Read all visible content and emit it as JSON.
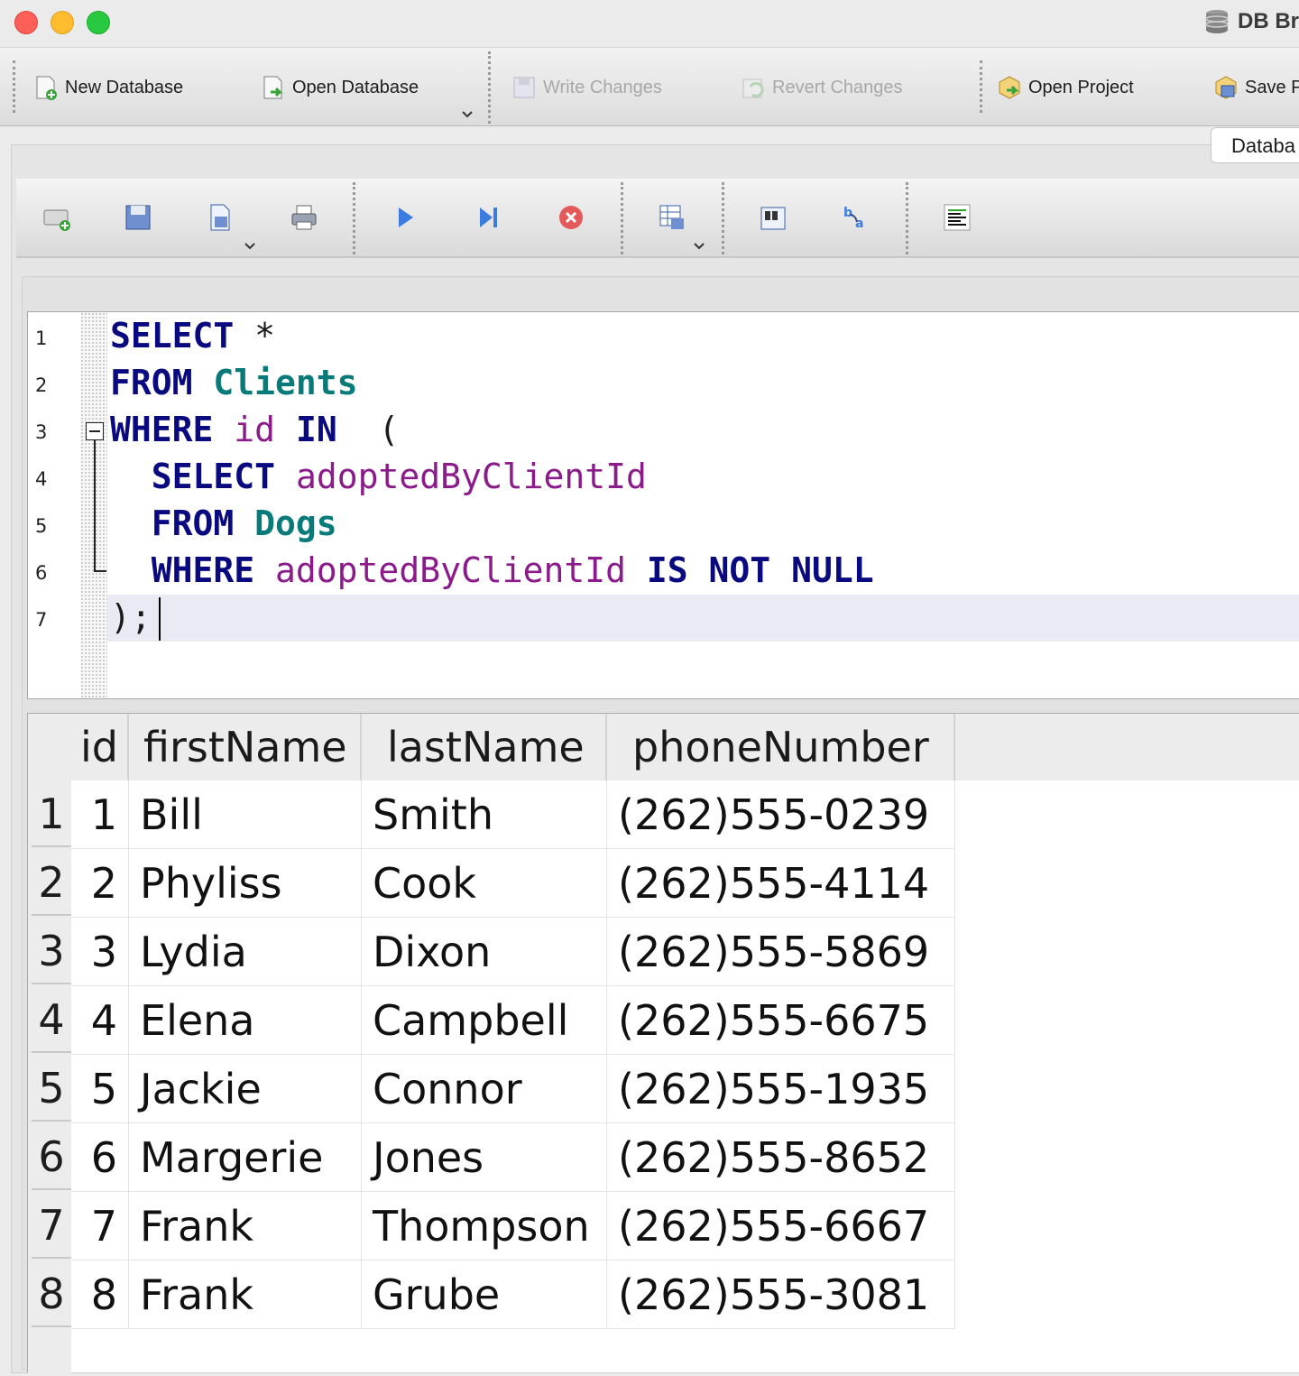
{
  "window": {
    "title": "DB Br"
  },
  "toolbar": {
    "new_database": "New Database",
    "open_database": "Open Database",
    "write_changes": "Write Changes",
    "revert_changes": "Revert Changes",
    "open_project": "Open Project",
    "save_project": "Save P"
  },
  "tabs": {
    "active": "Databa"
  },
  "editor": {
    "line_numbers": [
      "1",
      "2",
      "3",
      "4",
      "5",
      "6",
      "7"
    ],
    "lines": [
      [
        {
          "t": "kw",
          "v": "SELECT"
        },
        {
          "t": "p",
          "v": " *"
        }
      ],
      [
        {
          "t": "kw",
          "v": "FROM"
        },
        {
          "t": "p",
          "v": " "
        },
        {
          "t": "tbl",
          "v": "Clients"
        }
      ],
      [
        {
          "t": "kw",
          "v": "WHERE"
        },
        {
          "t": "p",
          "v": " "
        },
        {
          "t": "col",
          "v": "id"
        },
        {
          "t": "p",
          "v": " "
        },
        {
          "t": "kw",
          "v": "IN"
        },
        {
          "t": "p",
          "v": "  ("
        }
      ],
      [
        {
          "t": "p",
          "v": "  "
        },
        {
          "t": "kw",
          "v": "SELECT"
        },
        {
          "t": "p",
          "v": " "
        },
        {
          "t": "col",
          "v": "adoptedByClientId"
        }
      ],
      [
        {
          "t": "p",
          "v": "  "
        },
        {
          "t": "kw",
          "v": "FROM"
        },
        {
          "t": "p",
          "v": " "
        },
        {
          "t": "tbl",
          "v": "Dogs"
        }
      ],
      [
        {
          "t": "p",
          "v": "  "
        },
        {
          "t": "kw",
          "v": "WHERE"
        },
        {
          "t": "p",
          "v": " "
        },
        {
          "t": "col",
          "v": "adoptedByClientId"
        },
        {
          "t": "p",
          "v": " "
        },
        {
          "t": "kw",
          "v": "IS"
        },
        {
          "t": "p",
          "v": " "
        },
        {
          "t": "kw",
          "v": "NOT"
        },
        {
          "t": "p",
          "v": " "
        },
        {
          "t": "kw",
          "v": "NULL"
        }
      ],
      [
        {
          "t": "p",
          "v": ");"
        }
      ]
    ]
  },
  "results": {
    "columns": [
      "id",
      "firstName",
      "lastName",
      "phoneNumber"
    ],
    "rows": [
      [
        "1",
        "1",
        "Bill",
        "Smith",
        "(262)555-0239"
      ],
      [
        "2",
        "2",
        "Phyliss",
        "Cook",
        "(262)555-4114"
      ],
      [
        "3",
        "3",
        "Lydia",
        "Dixon",
        "(262)555-5869"
      ],
      [
        "4",
        "4",
        "Elena",
        "Campbell",
        "(262)555-6675"
      ],
      [
        "5",
        "5",
        "Jackie",
        "Connor",
        "(262)555-1935"
      ],
      [
        "6",
        "6",
        "Margerie",
        "Jones",
        "(262)555-8652"
      ],
      [
        "7",
        "7",
        "Frank",
        "Thompson",
        "(262)555-6667"
      ],
      [
        "8",
        "8",
        "Frank",
        "Grube",
        "(262)555-3081"
      ]
    ]
  }
}
